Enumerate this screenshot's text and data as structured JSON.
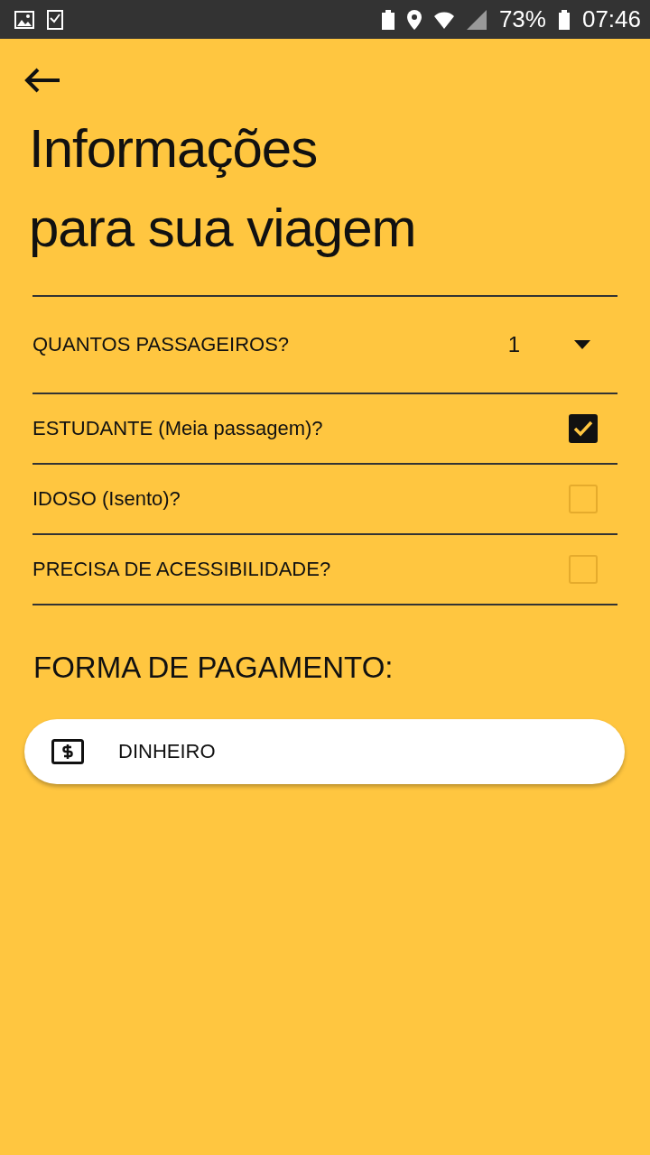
{
  "status_bar": {
    "battery": "73%",
    "time": "07:46"
  },
  "title": "Informações\npara sua viagem",
  "rows": [
    {
      "kind": "select",
      "label": "QUANTOS PASSAGEIROS?",
      "value": "1"
    },
    {
      "kind": "checkbox",
      "label": "ESTUDANTE (Meia passagem)?",
      "checked": true
    },
    {
      "kind": "checkbox",
      "label": "IDOSO (Isento)?",
      "checked": false
    },
    {
      "kind": "checkbox",
      "label": "PRECISA DE ACESSIBILIDADE?",
      "checked": false
    }
  ],
  "payment": {
    "heading": "FORMA DE PAGAMENTO:",
    "option": "DINHEIRO"
  }
}
